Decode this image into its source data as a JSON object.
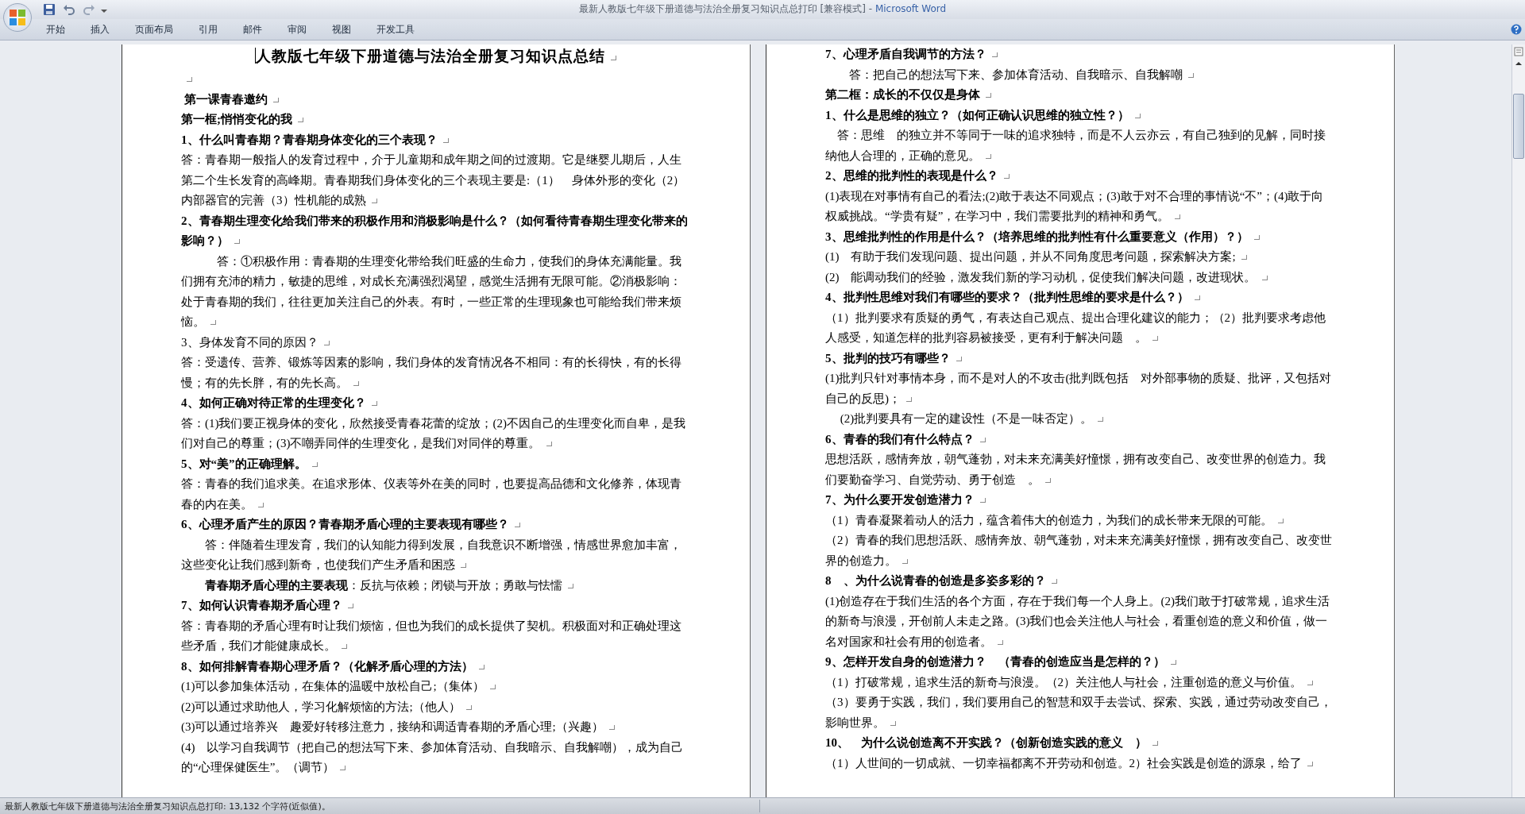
{
  "window": {
    "title": "最新人教版七年级下册道德与法治全册复习知识点总打印 [兼容模式] - ",
    "app_name": "Microsoft Word"
  },
  "ribbon": {
    "tabs": [
      {
        "label": "开始",
        "selected": false
      },
      {
        "label": "插入",
        "selected": false
      },
      {
        "label": "页面布局",
        "selected": false
      },
      {
        "label": "引用",
        "selected": false
      },
      {
        "label": "邮件",
        "selected": false
      },
      {
        "label": "审阅",
        "selected": false
      },
      {
        "label": "视图",
        "selected": false
      },
      {
        "label": "开发工具",
        "selected": false
      }
    ]
  },
  "pages": [
    {
      "paragraphs": [
        {
          "kind": "title",
          "text": "人教版七年级下册道德与法治全册复习知识点总结"
        },
        {
          "kind": "blank"
        },
        {
          "kind": "heading",
          "text": " 第一课青春邀约"
        },
        {
          "kind": "heading",
          "text": "第一框;悄悄变化的我"
        },
        {
          "kind": "heading",
          "text": "1、什么叫青春期？青春期身体变化的三个表现？"
        },
        {
          "kind": "text",
          "text": "答：青春期一般指人的发育过程中，介于儿童期和成年期之间的过渡期。它是继婴儿期后，人生第二个生长发育的高峰期。青春期我们身体变化的三个表现主要是:（1）　身体外形的变化（2）内部器官的完善（3）性机能的成熟"
        },
        {
          "kind": "heading",
          "text": "2、青春期生理变化给我们带来的积极作用和消极影响是什么？（如何看待青春期生理变化带来的影响？）"
        },
        {
          "kind": "text",
          "text": "　　　答：①积极作用：青春期的生理变化带给我们旺盛的生命力，使我们的身体充满能量。我们拥有充沛的精力，敏捷的思维，对成长充满强烈渴望，感觉生活拥有无限可能。②消极影响：处于青春期的我们，往往更加关注自己的外表。有时，一些正常的生理现象也可能给我们带来烦恼。"
        },
        {
          "kind": "text",
          "text": "3、身体发育不同的原因？"
        },
        {
          "kind": "text",
          "text": "答：受遗传、营养、锻炼等因素的影响，我们身体的发育情况各不相同：有的长得快，有的长得慢；有的先长胖，有的先长高。"
        },
        {
          "kind": "heading",
          "text": "4、如何正确对待正常的生理变化？"
        },
        {
          "kind": "text",
          "text": "答：(1)我们要正视身体的变化，欣然接受青春花蕾的绽放；(2)不因自己的生理变化而自卑，是我们对自己的尊重；(3)不嘲弄同伴的生理变化，是我们对同伴的尊重。"
        },
        {
          "kind": "heading",
          "text": "5、对“美”的正确理解。"
        },
        {
          "kind": "text",
          "text": "答：青春的我们追求美。在追求形体、仪表等外在美的同时，也要提高品德和文化修养，体现青春的内在美。"
        },
        {
          "kind": "heading",
          "text": "6、心理矛盾产生的原因？青春期矛盾心理的主要表现有哪些？"
        },
        {
          "kind": "text",
          "text": "　　答：伴随着生理发育，我们的认知能力得到发展，自我意识不断增强，情感世界愈加丰富，这些变化让我们感到新奇，也使我们产生矛盾和困惑"
        },
        {
          "kind": "text",
          "text": "　　**青春期矛盾心理的主要表现**：反抗与依赖；闭锁与开放；勇敢与怯懦"
        },
        {
          "kind": "heading",
          "text": "7、如何认识青春期矛盾心理？"
        },
        {
          "kind": "text",
          "text": "答：青春期的矛盾心理有时让我们烦恼，但也为我们的成长提供了契机。积极面对和正确处理这些矛盾，我们才能健康成长。"
        },
        {
          "kind": "heading",
          "text": "8、如何排解青春期心理矛盾？（化解矛盾心理的方法）"
        },
        {
          "kind": "text",
          "text": "(1)可以参加集体活动，在集体的温暖中放松自己;（集体）"
        },
        {
          "kind": "text",
          "text": "(2)可以通过求助他人，学习化解烦恼的方法;（他人）"
        },
        {
          "kind": "text",
          "text": "(3)可以通过培养兴　趣爱好转移注意力，接纳和调适青春期的矛盾心理;（兴趣）"
        },
        {
          "kind": "text",
          "text": "(4)　以学习自我调节（把自己的想法写下来、参加体育活动、自我暗示、自我解嘲），成为自己的“心理保健医生”。（调节）"
        }
      ]
    },
    {
      "paragraphs": [
        {
          "kind": "heading",
          "text": "7、心理矛盾自我调节的方法？"
        },
        {
          "kind": "text",
          "text": "　　答：把自己的想法写下来、参加体育活动、自我暗示、自我解嘲"
        },
        {
          "kind": "heading",
          "text": "第二框：成长的不仅仅是身体"
        },
        {
          "kind": "heading",
          "text": "1、什么是思维的独立？（如何正确认识思维的独立性？）"
        },
        {
          "kind": "text",
          "text": "　答：思维　的独立并不等同于一味的追求独特，而是不人云亦云，有自己独到的见解，同时接纳他人合理的，正确的意见。"
        },
        {
          "kind": "heading",
          "text": "2、思维的批判性的表现是什么？"
        },
        {
          "kind": "text",
          "text": "(1)表现在对事情有自己的看法;(2)敢于表达不同观点；(3)敢于对不合理的事情说“不”；(4)敢于向权威挑战。“学贵有疑”，在学习中，我们需要批判的精神和勇气。"
        },
        {
          "kind": "heading",
          "text": "3、思维批判性的作用是什么？（培养思维的批判性有什么重要意义（作用）？）"
        },
        {
          "kind": "text",
          "text": "(1)　有助于我们发现问题、提出问题，并从不同角度思考问题，探索解决方案;"
        },
        {
          "kind": "text",
          "text": "(2)　能调动我们的经验，激发我们新的学习动机，促使我们解决问题，改进现状。"
        },
        {
          "kind": "heading",
          "text": "4、批判性思维对我们有哪些的要求？（批判性思维的要求是什么？）"
        },
        {
          "kind": "text",
          "text": "（1）批判要求有质疑的勇气，有表达自己观点、提出合理化建议的能力；（2）批判要求考虑他人感受，知道怎样的批判容易被接受，更有利于解决问题　。"
        },
        {
          "kind": "heading",
          "text": "5、批判的技巧有哪些？"
        },
        {
          "kind": "text",
          "text": "(1)批判只针对事情本身，而不是对人的不攻击(批判既包括　对外部事物的质疑、批评，又包括对自己的反思)；"
        },
        {
          "kind": "text",
          "text": " 　(2)批判要具有一定的建设性（不是一味否定）。"
        },
        {
          "kind": "heading",
          "text": "6、青春的我们有什么特点？"
        },
        {
          "kind": "text",
          "text": "思想活跃，感情奔放，朝气蓬勃，对未来充满美好憧憬，拥有改变自己、改变世界的创造力。我们要勤奋学习、自觉劳动、勇于创造　。"
        },
        {
          "kind": "heading",
          "text": "7、为什么要开发创造潜力？"
        },
        {
          "kind": "text",
          "text": "（1）青春凝聚着动人的活力，蕴含着伟大的创造力，为我们的成长带来无限的可能。"
        },
        {
          "kind": "text",
          "text": "（2）青春的我们思想活跃、感情奔放、朝气蓬勃，对未来充满美好憧憬，拥有改变自己、改变世界的创造力。"
        },
        {
          "kind": "heading",
          "text": "8　、为什么说青春的创造是多姿多彩的？"
        },
        {
          "kind": "text",
          "text": "(1)创造存在于我们生活的各个方面，存在于我们每一个人身上。(2)我们敢于打破常规，追求生活的新奇与浪漫，开创前人未走之路。(3)我们也会关注他人与社会，看重创造的意义和价值，做一名对国家和社会有用的创造者。"
        },
        {
          "kind": "heading",
          "text": "9、怎样开发自身的创造潜力？　（青春的创造应当是怎样的？）"
        },
        {
          "kind": "text",
          "text": "（1）打破常规，追求生活的新奇与浪漫。（2）关注他人与社会，注重创造的意义与价值。"
        },
        {
          "kind": "text",
          "text": "（3）要勇于实践，我们，我们要用自己的智慧和双手去尝试、探索、实践，通过劳动改变自己，影响世界。"
        },
        {
          "kind": "heading",
          "text": "10、　为什么说创造离不开实践？（创新创造实践的意义　）"
        },
        {
          "kind": "text",
          "text": "（1）人世间的一切成就、一切幸福都离不开劳动和创造。2）社会实践是创造的源泉，给了"
        }
      ]
    }
  ],
  "status_bar": {
    "text": "最新人教版七年级下册道德与法治全册复习知识点总打印: 13,132 个字符(近似值)。"
  }
}
